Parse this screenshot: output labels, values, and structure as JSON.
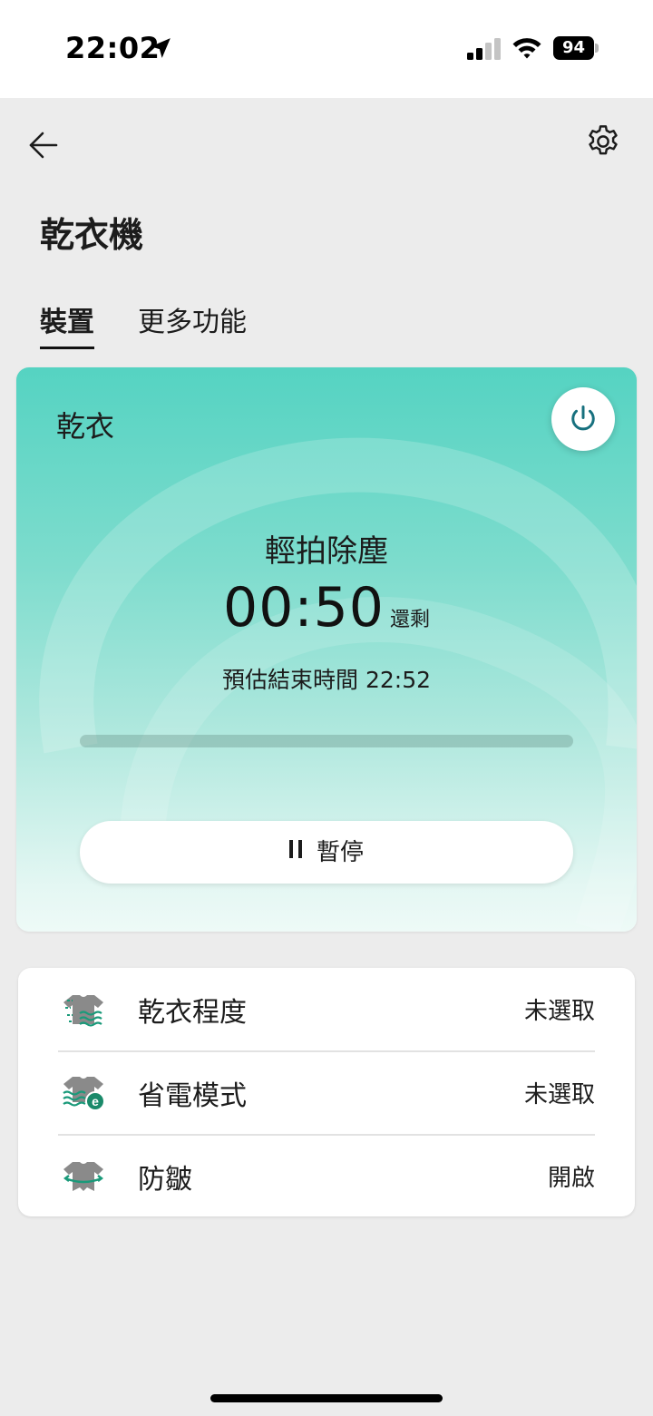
{
  "status_bar": {
    "time": "22:02",
    "battery": "94",
    "icons": [
      "location-arrow-icon",
      "cellular-signal-icon",
      "wifi-icon",
      "battery-icon"
    ]
  },
  "header": {
    "title": "乾衣機",
    "back_icon": "arrow-left-icon",
    "settings_icon": "gear-icon"
  },
  "tabs": [
    {
      "label": "裝置",
      "active": true
    },
    {
      "label": "更多功能",
      "active": false
    }
  ],
  "status_card": {
    "mode": "乾衣",
    "power_icon": "power-icon",
    "stage": "輕拍除塵",
    "time_remaining": "00:50",
    "time_suffix": "還剩",
    "eta_label": "預估結束時間",
    "eta_time": "22:52",
    "progress_percent": 0,
    "pause_label": "暫停",
    "pause_icon": "pause-icon",
    "colors": {
      "gradient_top": "#55d3c2",
      "gradient_bottom": "#eefaf7",
      "accent": "#17707e"
    }
  },
  "options": [
    {
      "icon": "dryness-level-icon",
      "label": "乾衣程度",
      "value": "未選取"
    },
    {
      "icon": "eco-mode-icon",
      "label": "省電模式",
      "value": "未選取"
    },
    {
      "icon": "wrinkle-care-icon",
      "label": "防皺",
      "value": "開啟"
    }
  ]
}
